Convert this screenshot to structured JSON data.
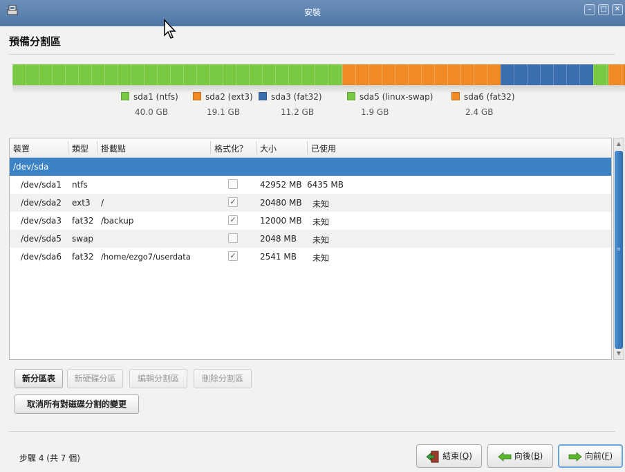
{
  "window": {
    "title": "安裝"
  },
  "page": {
    "title": "預備分割區"
  },
  "partitions": [
    {
      "name": "sda1 (ntfs)",
      "size": "40.0 GB",
      "color": "#7ac943"
    },
    {
      "name": "sda2 (ext3)",
      "size": "19.1 GB",
      "color": "#f08a24"
    },
    {
      "name": "sda3 (fat32)",
      "size": "11.2 GB",
      "color": "#3b6eaf"
    },
    {
      "name": "sda5 (linux-swap)",
      "size": "1.9 GB",
      "color": "#7ac943"
    },
    {
      "name": "sda6 (fat32)",
      "size": "2.4 GB",
      "color": "#f08a24"
    }
  ],
  "table": {
    "columns": [
      "裝置",
      "類型",
      "掛載點",
      "格式化？",
      "大小",
      "已使用"
    ],
    "disk_row": "/dev/sda",
    "rows": [
      {
        "device": "/dev/sda1",
        "type": "ntfs",
        "mount": "",
        "format": false,
        "size": "42952 MB",
        "used": "6435 MB"
      },
      {
        "device": "/dev/sda2",
        "type": "ext3",
        "mount": "/",
        "format": true,
        "size": "20480 MB",
        "used": "未知"
      },
      {
        "device": "/dev/sda3",
        "type": "fat32",
        "mount": "/backup",
        "format": true,
        "size": "12000 MB",
        "used": "未知"
      },
      {
        "device": "/dev/sda5",
        "type": "swap",
        "mount": "",
        "format": false,
        "size": "2048 MB",
        "used": "未知"
      },
      {
        "device": "/dev/sda6",
        "type": "fat32",
        "mount": "/home/ezgo7/userdata",
        "format": true,
        "size": "2541 MB",
        "used": "未知"
      }
    ]
  },
  "actions": {
    "new_table": "新分區表",
    "new_partition": "新硬碟分區",
    "edit_partition": "編輯分割區",
    "delete_partition": "刪除分割區",
    "undo_all": "取消所有對磁碟分割的變更"
  },
  "footer": {
    "step": "步驟 4 (共 7 個)",
    "quit_label": "結束(",
    "quit_key": "Q",
    "back_label": "向後(",
    "back_key": "B",
    "forward_label": "向前(",
    "forward_key": "F",
    "close_paren": ")"
  },
  "icons": {
    "app": "installer-icon",
    "quit": "exit-door-icon",
    "back": "arrow-left-icon",
    "forward": "arrow-right-icon"
  },
  "colors": {
    "titlebar": "#5a80ad",
    "selection": "#3b83c4",
    "swap_green": "#7ac943",
    "orange": "#f08a24",
    "blue": "#3b6eaf"
  }
}
